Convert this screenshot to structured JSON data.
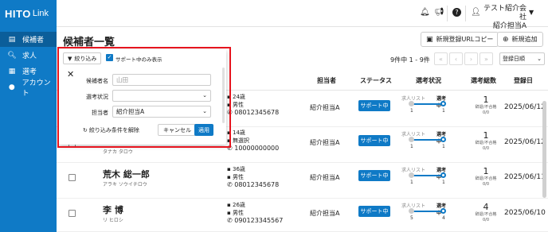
{
  "app": {
    "logo_bold": "HITO",
    "logo_light": "Link"
  },
  "sidebar": {
    "items": [
      {
        "label": "候補者",
        "icon": "candidates-icon",
        "active": true
      },
      {
        "label": "求人",
        "icon": "search-icon",
        "active": false
      },
      {
        "label": "選考",
        "icon": "selection-icon",
        "active": false
      },
      {
        "label": "アカウント",
        "icon": "account-icon",
        "active": false
      }
    ]
  },
  "topbar": {
    "company_line1": "テスト紹介会社",
    "company_line2": "紹介担当A"
  },
  "page": {
    "title": "候補者一覧",
    "url_copy_label": "新規登録URLコピー",
    "add_label": "新規追加",
    "count_text": "9件中 1 - 9件",
    "sort_label": "登録日順"
  },
  "table": {
    "headers": [
      "担当者",
      "ステータス",
      "選考状況",
      "選考総数",
      "登録日"
    ],
    "rows": [
      {
        "name": "",
        "kana": "",
        "age": "24歳",
        "gender": "男性",
        "phone": "08012345678",
        "agent": "紹介担当A",
        "status": "サポート中",
        "stage1": "求人リスト",
        "stage2": "選考中",
        "n1": "1",
        "n2": "1",
        "total": "1",
        "total_sub1": "辞退/不合格",
        "total_sub2": "0/0",
        "date": "2025/06/12"
      },
      {
        "name": "",
        "kana": "タナカ タロウ",
        "age": "14歳",
        "gender": "無選択",
        "phone": "10000000000",
        "agent": "紹介担当A",
        "status": "サポート中",
        "stage1": "求人リスト",
        "stage2": "選考中",
        "n1": "1",
        "n2": "1",
        "total": "1",
        "total_sub1": "辞退/不合格",
        "total_sub2": "0/0",
        "date": "2025/06/12"
      },
      {
        "name": "荒木 総一郎",
        "kana": "アラキ ソウイチロウ",
        "age": "36歳",
        "gender": "男性",
        "phone": "08012345678",
        "agent": "紹介担当A",
        "status": "サポート中",
        "stage1": "求人リスト",
        "stage2": "選考中",
        "n1": "1",
        "n2": "1",
        "total": "1",
        "total_sub1": "辞退/不合格",
        "total_sub2": "0/0",
        "date": "2025/06/11"
      },
      {
        "name": "李 博",
        "kana": "リ ヒロシ",
        "age": "26歳",
        "gender": "男性",
        "phone": "090123345567",
        "agent": "紹介担当A",
        "status": "サポート中",
        "stage1": "求人リスト",
        "stage2": "選考中",
        "n1": "5",
        "n2": "4",
        "total": "4",
        "total_sub1": "辞退/不合格",
        "total_sub2": "0/0",
        "date": "2025/06/10"
      }
    ]
  },
  "filter": {
    "toggle_label": "絞り込み",
    "support_only_label": "サポート中のみ表示",
    "name_label": "候補者名",
    "name_value": "山田",
    "stage_label": "選考状況",
    "stage_value": "",
    "agent_label": "担当者",
    "agent_value": "紹介担当A",
    "clear_label": "絞り込み条件を解除",
    "cancel_label": "キャンセル",
    "apply_label": "適用"
  },
  "colors": {
    "brand": "#0f7ac6",
    "highlight": "#e6141e"
  }
}
